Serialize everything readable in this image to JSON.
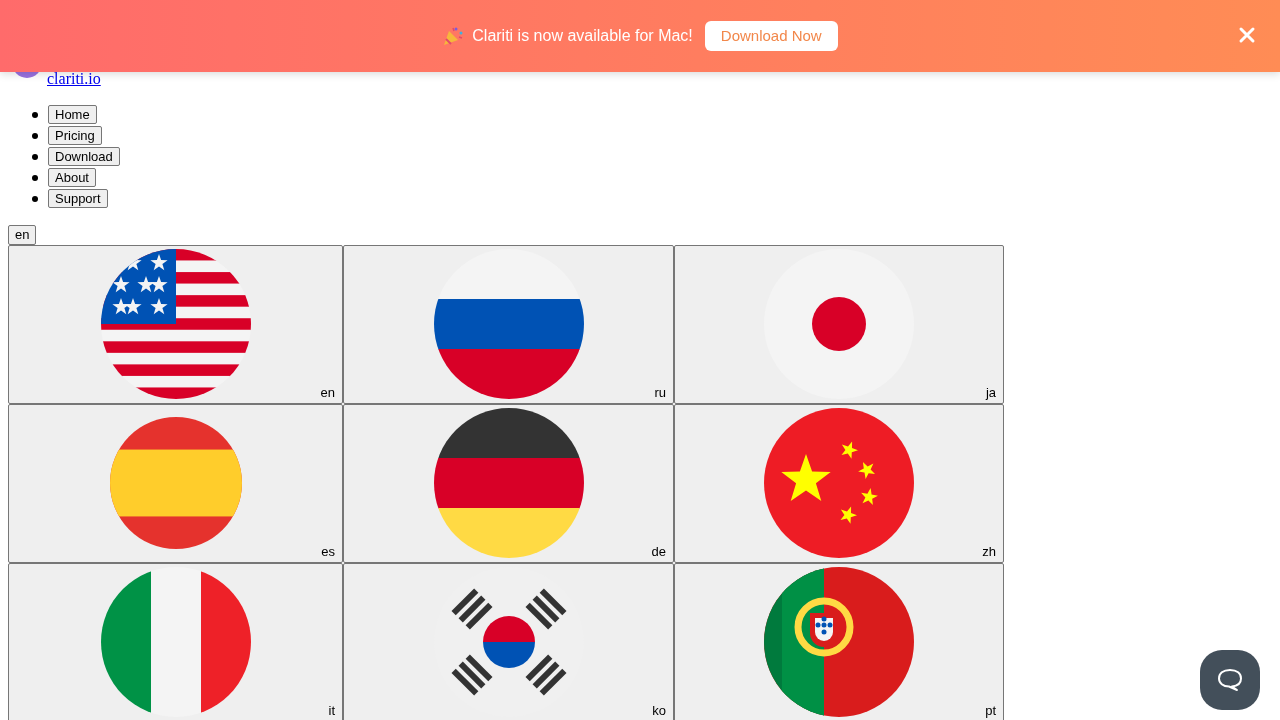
{
  "banner": {
    "message": "Clariti is now available for Mac!",
    "action": "Download Now"
  },
  "logo": {
    "text": "clariti.io"
  },
  "nav": [
    {
      "label": "Home"
    },
    {
      "label": "Pricing"
    },
    {
      "label": "Download"
    },
    {
      "label": "About"
    },
    {
      "label": "Support"
    }
  ],
  "language_button": "en",
  "languages": [
    {
      "code": "en",
      "kind": "us"
    },
    {
      "code": "ru",
      "kind": "ru"
    },
    {
      "code": "ja",
      "kind": "jp"
    },
    {
      "code": "es",
      "kind": "es"
    },
    {
      "code": "de",
      "kind": "de"
    },
    {
      "code": "zh",
      "kind": "cn"
    },
    {
      "code": "it",
      "kind": "it"
    },
    {
      "code": "ko",
      "kind": "kr"
    },
    {
      "code": "pt",
      "kind": "pt"
    }
  ]
}
